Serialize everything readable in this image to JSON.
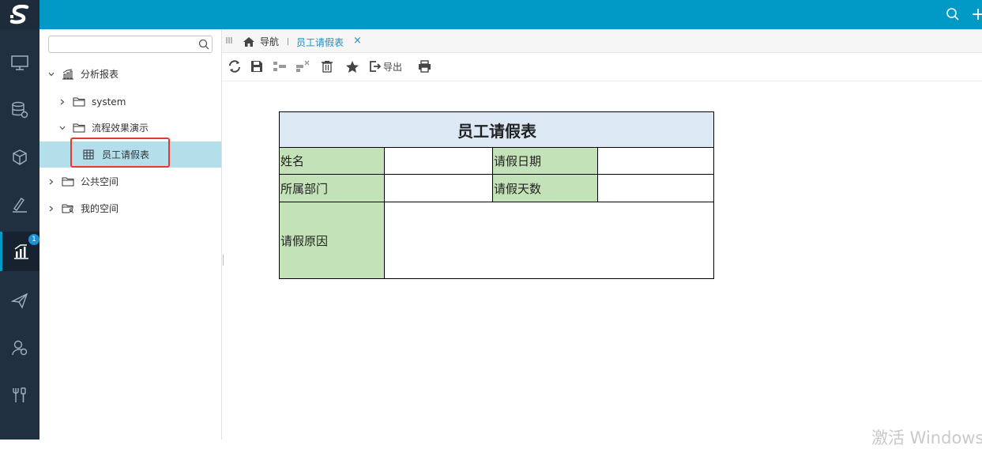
{
  "tree": {
    "search_placeholder": "",
    "nodes": [
      {
        "label": "分析报表"
      },
      {
        "label": "system"
      },
      {
        "label": "流程效果演示"
      },
      {
        "label": "员工请假表"
      },
      {
        "label": "公共空间"
      },
      {
        "label": "我的空间"
      }
    ]
  },
  "rail": {
    "badge_count": "1"
  },
  "tabs": {
    "home_label": "导航",
    "active_label": "员工请假表",
    "close_glyph": "×"
  },
  "toolbar": {
    "export_label": "导出"
  },
  "report": {
    "title": "员工请假表",
    "name_label": "姓名",
    "leave_date_label": "请假日期",
    "department_label": "所属部门",
    "leave_days_label": "请假天数",
    "reason_label": "请假原因"
  },
  "watermark": "激活 Windows",
  "colors": {
    "accent": "#0199c6",
    "rail": "#213040",
    "selected_row": "#b3dfeb",
    "label_fill": "#c4e2b8",
    "title_fill": "#dce9f5",
    "highlight": "#e8382e"
  }
}
